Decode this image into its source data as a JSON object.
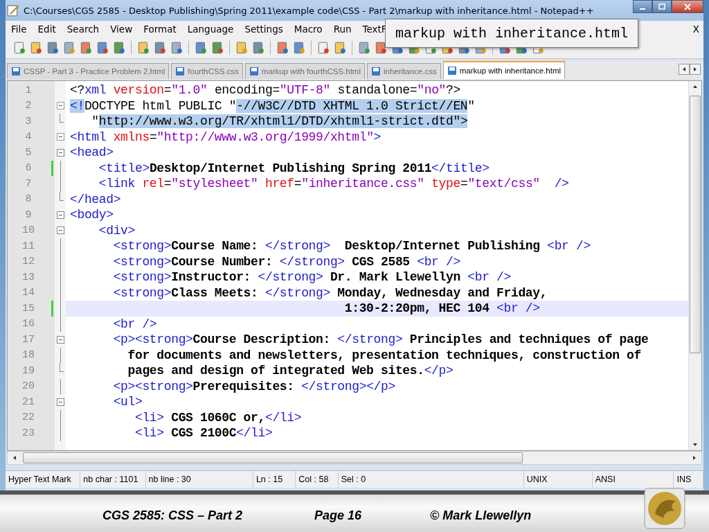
{
  "window": {
    "title": "C:\\Courses\\CGS 2585 - Desktop Publishing\\Spring 2011\\example code\\CSS - Part 2\\markup with inheritance.html - Notepad++"
  },
  "menu": [
    "File",
    "Edit",
    "Search",
    "View",
    "Format",
    "Language",
    "Settings",
    "Macro",
    "Run",
    "TextF"
  ],
  "menu_close": "X",
  "tooltip": "markup with inheritance.html",
  "tabs": [
    {
      "label": "CSSP - Part 3 - Practice Problem 2.html",
      "selected": false
    },
    {
      "label": "fourthCSS.css",
      "selected": false
    },
    {
      "label": "markup with fourthCSS.html",
      "selected": false
    },
    {
      "label": "inheritance.css",
      "selected": false
    },
    {
      "label": "markup with inheritance.html",
      "selected": true
    }
  ],
  "editor": {
    "lines": [
      {
        "number": "1",
        "foldable": false,
        "fold_end": false,
        "in_fold": false,
        "changed": false,
        "current": false,
        "segments": [
          {
            "text": "<?",
            "kind": "plain"
          },
          {
            "text": "xml",
            "kind": "tag"
          },
          {
            "text": " version",
            "kind": "attr"
          },
          {
            "text": "=",
            "kind": "plain"
          },
          {
            "text": "\"1.0\"",
            "kind": "value"
          },
          {
            "text": " encoding=",
            "kind": "plain"
          },
          {
            "text": "\"UTF-8\"",
            "kind": "value"
          },
          {
            "text": " standalone=",
            "kind": "plain"
          },
          {
            "text": "\"no\"",
            "kind": "value"
          },
          {
            "text": "?>",
            "kind": "plain"
          }
        ]
      },
      {
        "number": "2",
        "foldable": true,
        "fold_end": false,
        "in_fold": false,
        "changed": false,
        "current": false,
        "segments": [
          {
            "text": "<!",
            "kind": "tag",
            "selected": true
          },
          {
            "text": "DOCTYPE html PUBLIC \"",
            "kind": "plain",
            "selected": false
          },
          {
            "text": "-//W3C//DTD XHTML 1.0 Strict//EN",
            "kind": "plain",
            "selected": true
          },
          {
            "text": "\"",
            "kind": "plain",
            "selected": false
          }
        ]
      },
      {
        "number": "3",
        "foldable": false,
        "fold_end": true,
        "in_fold": true,
        "changed": false,
        "current": false,
        "segments": [
          {
            "text": "   \"",
            "kind": "plain",
            "selected": false
          },
          {
            "text": "http://www.w3.org/TR/xhtml1/DTD/xhtml1-strict.dtd",
            "kind": "plain",
            "selected": true
          },
          {
            "text": "\">",
            "kind": "plain",
            "selected": true
          }
        ]
      },
      {
        "number": "4",
        "foldable": true,
        "fold_end": false,
        "in_fold": false,
        "changed": false,
        "current": false,
        "segments": [
          {
            "text": "<html ",
            "kind": "tag"
          },
          {
            "text": "xmlns",
            "kind": "attr"
          },
          {
            "text": "=",
            "kind": "plain"
          },
          {
            "text": "\"http://www.w3.org/1999/xhtml\"",
            "kind": "value"
          },
          {
            "text": ">",
            "kind": "tag"
          }
        ]
      },
      {
        "number": "5",
        "foldable": true,
        "fold_end": false,
        "in_fold": true,
        "changed": false,
        "current": false,
        "segments": [
          {
            "text": "<head>",
            "kind": "tag"
          }
        ]
      },
      {
        "number": "6",
        "foldable": false,
        "fold_end": false,
        "in_fold": true,
        "changed": true,
        "current": false,
        "segments": [
          {
            "text": "    <title>",
            "kind": "tag"
          },
          {
            "text": "Desktop/Internet Publishing Spring 2011",
            "kind": "text"
          },
          {
            "text": "</title>",
            "kind": "tag"
          }
        ]
      },
      {
        "number": "7",
        "foldable": false,
        "fold_end": false,
        "in_fold": true,
        "changed": false,
        "current": false,
        "segments": [
          {
            "text": "    <link ",
            "kind": "tag"
          },
          {
            "text": "rel",
            "kind": "attr"
          },
          {
            "text": "=",
            "kind": "plain"
          },
          {
            "text": "\"stylesheet\"",
            "kind": "value"
          },
          {
            "text": " href",
            "kind": "attr"
          },
          {
            "text": "=",
            "kind": "plain"
          },
          {
            "text": "\"inheritance.css\"",
            "kind": "value"
          },
          {
            "text": " type",
            "kind": "attr"
          },
          {
            "text": "=",
            "kind": "plain"
          },
          {
            "text": "\"text/css\"",
            "kind": "value"
          },
          {
            "text": "  />",
            "kind": "tag"
          }
        ]
      },
      {
        "number": "8",
        "foldable": false,
        "fold_end": true,
        "in_fold": true,
        "changed": false,
        "current": false,
        "segments": [
          {
            "text": "</head>",
            "kind": "tag"
          }
        ]
      },
      {
        "number": "9",
        "foldable": true,
        "fold_end": false,
        "in_fold": true,
        "changed": false,
        "current": false,
        "segments": [
          {
            "text": "<body>",
            "kind": "tag"
          }
        ]
      },
      {
        "number": "10",
        "foldable": true,
        "fold_end": false,
        "in_fold": true,
        "changed": false,
        "current": false,
        "segments": [
          {
            "text": "    <div>",
            "kind": "tag"
          }
        ]
      },
      {
        "number": "11",
        "foldable": false,
        "fold_end": false,
        "in_fold": true,
        "changed": false,
        "current": false,
        "segments": [
          {
            "text": "      <strong>",
            "kind": "tag"
          },
          {
            "text": "Course Name: ",
            "kind": "text"
          },
          {
            "text": "</strong>",
            "kind": "tag"
          },
          {
            "text": "  Desktop/Internet Publishing ",
            "kind": "text"
          },
          {
            "text": "<br />",
            "kind": "tag"
          }
        ]
      },
      {
        "number": "12",
        "foldable": false,
        "fold_end": false,
        "in_fold": true,
        "changed": false,
        "current": false,
        "segments": [
          {
            "text": "      <strong>",
            "kind": "tag"
          },
          {
            "text": "Course Number: ",
            "kind": "text"
          },
          {
            "text": "</strong>",
            "kind": "tag"
          },
          {
            "text": " CGS 2585 ",
            "kind": "text"
          },
          {
            "text": "<br />",
            "kind": "tag"
          }
        ]
      },
      {
        "number": "13",
        "foldable": false,
        "fold_end": false,
        "in_fold": true,
        "changed": false,
        "current": false,
        "segments": [
          {
            "text": "      <strong>",
            "kind": "tag"
          },
          {
            "text": "Instructor: ",
            "kind": "text"
          },
          {
            "text": "</strong>",
            "kind": "tag"
          },
          {
            "text": " Dr. Mark Llewellyn ",
            "kind": "text"
          },
          {
            "text": "<br />",
            "kind": "tag"
          }
        ]
      },
      {
        "number": "14",
        "foldable": false,
        "fold_end": false,
        "in_fold": true,
        "changed": false,
        "current": false,
        "segments": [
          {
            "text": "      <strong>",
            "kind": "tag"
          },
          {
            "text": "Class Meets: ",
            "kind": "text"
          },
          {
            "text": "</strong>",
            "kind": "tag"
          },
          {
            "text": " Monday, Wednesday and Friday,",
            "kind": "text"
          }
        ]
      },
      {
        "number": "15",
        "foldable": false,
        "fold_end": false,
        "in_fold": true,
        "changed": true,
        "current": true,
        "segments": [
          {
            "text": "                                      1:30-2:20pm, HEC 104 ",
            "kind": "text"
          },
          {
            "text": "<br />",
            "kind": "tag"
          }
        ]
      },
      {
        "number": "16",
        "foldable": false,
        "fold_end": false,
        "in_fold": true,
        "changed": false,
        "current": false,
        "segments": [
          {
            "text": "      <br />",
            "kind": "tag"
          }
        ]
      },
      {
        "number": "17",
        "foldable": true,
        "fold_end": false,
        "in_fold": true,
        "changed": false,
        "current": false,
        "segments": [
          {
            "text": "      <p><strong>",
            "kind": "tag"
          },
          {
            "text": "Course Description: ",
            "kind": "text"
          },
          {
            "text": "</strong>",
            "kind": "tag"
          },
          {
            "text": " Principles and techniques of page",
            "kind": "text"
          }
        ]
      },
      {
        "number": "18",
        "foldable": false,
        "fold_end": false,
        "in_fold": true,
        "changed": false,
        "current": false,
        "segments": [
          {
            "text": "        for documents and newsletters, presentation techniques, construction of",
            "kind": "text"
          }
        ]
      },
      {
        "number": "19",
        "foldable": false,
        "fold_end": true,
        "in_fold": true,
        "changed": false,
        "current": false,
        "segments": [
          {
            "text": "        pages and design of integrated Web sites.",
            "kind": "text"
          },
          {
            "text": "</p>",
            "kind": "tag"
          }
        ]
      },
      {
        "number": "20",
        "foldable": false,
        "fold_end": false,
        "in_fold": true,
        "changed": false,
        "current": false,
        "segments": [
          {
            "text": "      <p><strong>",
            "kind": "tag"
          },
          {
            "text": "Prerequisites: ",
            "kind": "text"
          },
          {
            "text": "</strong></p>",
            "kind": "tag"
          }
        ]
      },
      {
        "number": "21",
        "foldable": true,
        "fold_end": false,
        "in_fold": true,
        "changed": false,
        "current": false,
        "segments": [
          {
            "text": "      <ul>",
            "kind": "tag"
          }
        ]
      },
      {
        "number": "22",
        "foldable": false,
        "fold_end": false,
        "in_fold": true,
        "changed": false,
        "current": false,
        "segments": [
          {
            "text": "         <li>",
            "kind": "tag"
          },
          {
            "text": " CGS 1060C or,",
            "kind": "text"
          },
          {
            "text": "</li>",
            "kind": "tag"
          }
        ]
      },
      {
        "number": "23",
        "foldable": false,
        "fold_end": false,
        "in_fold": true,
        "changed": false,
        "current": false,
        "segments": [
          {
            "text": "         <li>",
            "kind": "tag"
          },
          {
            "text": " CGS 2100C",
            "kind": "text"
          },
          {
            "text": "</li>",
            "kind": "tag"
          }
        ]
      }
    ]
  },
  "status_bar": [
    "Hyper Text Mark",
    "nb char : 1101",
    "nb line : 30",
    "Ln : 15",
    "Col : 58",
    "Sel : 0",
    "UNIX",
    "ANSI",
    "INS"
  ],
  "footer": {
    "course": "CGS 2585: CSS – Part 2",
    "page": "Page 16",
    "author": "© Mark Llewellyn"
  }
}
